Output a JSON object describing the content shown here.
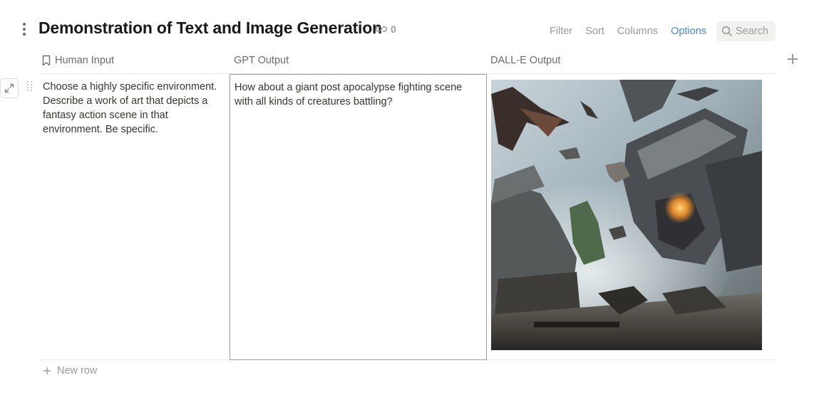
{
  "header": {
    "title": "Demonstration of Text and Image Generation",
    "link_count": "0"
  },
  "toolbar": {
    "filter": "Filter",
    "sort": "Sort",
    "columns": "Columns",
    "options": "Options",
    "search": "Search",
    "accent_color": "#4a86c6"
  },
  "table": {
    "columns": [
      {
        "label": "Human Input",
        "icon": "bookmark-icon"
      },
      {
        "label": "GPT Output",
        "icon": null
      },
      {
        "label": "DALL-E Output",
        "icon": null
      }
    ],
    "rows": [
      {
        "human_input": "Choose a highly specific environment. Describe a work of art that depicts a fantasy action scene in that environment. Be specific.",
        "gpt_output": "How about a giant post apocalypse fighting scene with all kinds of creatures battling?",
        "dalle_output": "image"
      }
    ],
    "new_row_label": "New row"
  }
}
